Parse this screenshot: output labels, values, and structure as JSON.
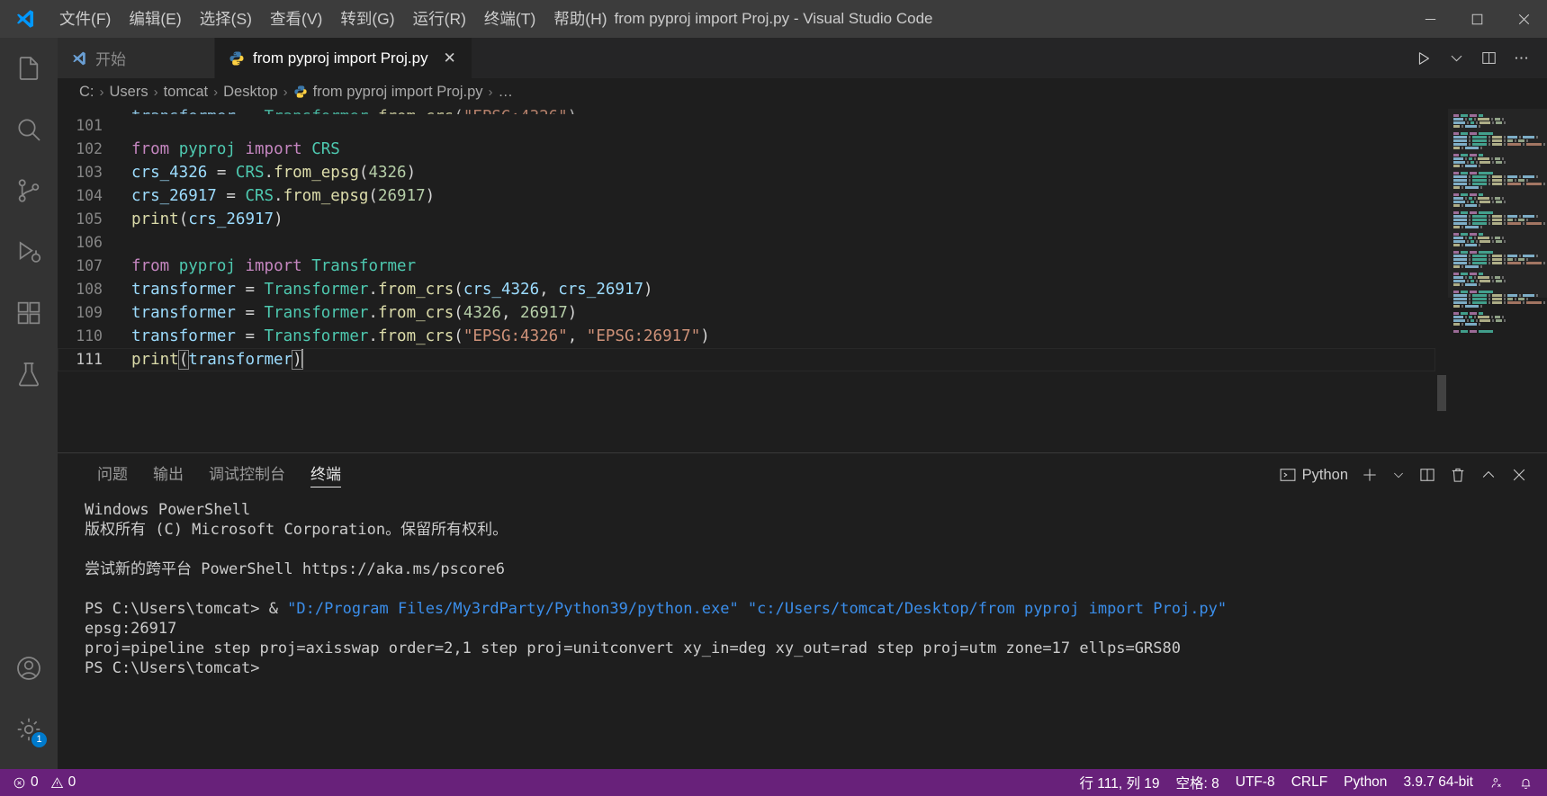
{
  "window": {
    "title": "from pyproj import Proj.py - Visual Studio Code",
    "minimize_label": "─",
    "maximize_label": "□",
    "close_label": "✕"
  },
  "menubar": {
    "items": [
      {
        "label": "文件(F)",
        "name": "menu-file"
      },
      {
        "label": "编辑(E)",
        "name": "menu-edit"
      },
      {
        "label": "选择(S)",
        "name": "menu-selection"
      },
      {
        "label": "查看(V)",
        "name": "menu-view"
      },
      {
        "label": "转到(G)",
        "name": "menu-go"
      },
      {
        "label": "运行(R)",
        "name": "menu-run"
      },
      {
        "label": "终端(T)",
        "name": "menu-terminal"
      },
      {
        "label": "帮助(H)",
        "name": "menu-help"
      }
    ]
  },
  "activitybar": {
    "items": [
      {
        "name": "explorer-icon",
        "title": "资源管理器"
      },
      {
        "name": "search-icon",
        "title": "搜索"
      },
      {
        "name": "source-control-icon",
        "title": "源代码管理"
      },
      {
        "name": "run-debug-icon",
        "title": "运行和调试"
      },
      {
        "name": "extensions-icon",
        "title": "扩展"
      },
      {
        "name": "testing-icon",
        "title": "测试"
      }
    ],
    "bottom": [
      {
        "name": "accounts-icon",
        "title": "帐户"
      },
      {
        "name": "settings-gear-icon",
        "title": "管理",
        "badge": "1"
      }
    ]
  },
  "tabs": [
    {
      "label": "开始",
      "icon": "vscode-icon",
      "active": false,
      "closable": false
    },
    {
      "label": "from pyproj import Proj.py",
      "icon": "python-icon",
      "active": true,
      "closable": true,
      "close_label": "✕"
    }
  ],
  "editor_actions": [
    {
      "name": "run-python-file-button",
      "icon": "play-icon"
    },
    {
      "name": "run-options-chevron-icon",
      "icon": "chevron-down-icon"
    },
    {
      "name": "split-editor-right-button",
      "icon": "split-icon"
    },
    {
      "name": "more-actions-button",
      "icon": "ellipsis-icon",
      "label": "⋯"
    }
  ],
  "breadcrumb": {
    "items": [
      "C:",
      "Users",
      "tomcat",
      "Desktop",
      "from pyproj import Proj.py",
      "…"
    ],
    "separator": "›",
    "file_icon": "python-icon"
  },
  "editor": {
    "first_visible_line": 101,
    "cursor_line": 111,
    "lines": [
      {
        "no": 101,
        "tokens": []
      },
      {
        "no": 102,
        "tokens": [
          {
            "t": "from",
            "c": "kw"
          },
          {
            "t": " ",
            "c": "pn"
          },
          {
            "t": "pyproj",
            "c": "typ"
          },
          {
            "t": " ",
            "c": "pn"
          },
          {
            "t": "import",
            "c": "kw"
          },
          {
            "t": " ",
            "c": "pn"
          },
          {
            "t": "CRS",
            "c": "typ"
          }
        ]
      },
      {
        "no": 103,
        "tokens": [
          {
            "t": "crs_4326",
            "c": "var"
          },
          {
            "t": " = ",
            "c": "pn"
          },
          {
            "t": "CRS",
            "c": "typ"
          },
          {
            "t": ".",
            "c": "pn"
          },
          {
            "t": "from_epsg",
            "c": "fn"
          },
          {
            "t": "(",
            "c": "pn"
          },
          {
            "t": "4326",
            "c": "num"
          },
          {
            "t": ")",
            "c": "pn"
          }
        ]
      },
      {
        "no": 104,
        "tokens": [
          {
            "t": "crs_26917",
            "c": "var"
          },
          {
            "t": " = ",
            "c": "pn"
          },
          {
            "t": "CRS",
            "c": "typ"
          },
          {
            "t": ".",
            "c": "pn"
          },
          {
            "t": "from_epsg",
            "c": "fn"
          },
          {
            "t": "(",
            "c": "pn"
          },
          {
            "t": "26917",
            "c": "num"
          },
          {
            "t": ")",
            "c": "pn"
          }
        ]
      },
      {
        "no": 105,
        "tokens": [
          {
            "t": "print",
            "c": "fn"
          },
          {
            "t": "(",
            "c": "pn"
          },
          {
            "t": "crs_26917",
            "c": "var"
          },
          {
            "t": ")",
            "c": "pn"
          }
        ]
      },
      {
        "no": 106,
        "tokens": []
      },
      {
        "no": 107,
        "tokens": [
          {
            "t": "from",
            "c": "kw"
          },
          {
            "t": " ",
            "c": "pn"
          },
          {
            "t": "pyproj",
            "c": "typ"
          },
          {
            "t": " ",
            "c": "pn"
          },
          {
            "t": "import",
            "c": "kw"
          },
          {
            "t": " ",
            "c": "pn"
          },
          {
            "t": "Transformer",
            "c": "typ"
          }
        ]
      },
      {
        "no": 108,
        "tokens": [
          {
            "t": "transformer",
            "c": "var"
          },
          {
            "t": " = ",
            "c": "pn"
          },
          {
            "t": "Transformer",
            "c": "typ"
          },
          {
            "t": ".",
            "c": "pn"
          },
          {
            "t": "from_crs",
            "c": "fn"
          },
          {
            "t": "(",
            "c": "pn"
          },
          {
            "t": "crs_4326",
            "c": "var"
          },
          {
            "t": ", ",
            "c": "pn"
          },
          {
            "t": "crs_26917",
            "c": "var"
          },
          {
            "t": ")",
            "c": "pn"
          }
        ]
      },
      {
        "no": 109,
        "tokens": [
          {
            "t": "transformer",
            "c": "var"
          },
          {
            "t": " = ",
            "c": "pn"
          },
          {
            "t": "Transformer",
            "c": "typ"
          },
          {
            "t": ".",
            "c": "pn"
          },
          {
            "t": "from_crs",
            "c": "fn"
          },
          {
            "t": "(",
            "c": "pn"
          },
          {
            "t": "4326",
            "c": "num"
          },
          {
            "t": ", ",
            "c": "pn"
          },
          {
            "t": "26917",
            "c": "num"
          },
          {
            "t": ")",
            "c": "pn"
          }
        ]
      },
      {
        "no": 110,
        "tokens": [
          {
            "t": "transformer",
            "c": "var"
          },
          {
            "t": " = ",
            "c": "pn"
          },
          {
            "t": "Transformer",
            "c": "typ"
          },
          {
            "t": ".",
            "c": "pn"
          },
          {
            "t": "from_crs",
            "c": "fn"
          },
          {
            "t": "(",
            "c": "pn"
          },
          {
            "t": "\"EPSG:4326\"",
            "c": "str"
          },
          {
            "t": ", ",
            "c": "pn"
          },
          {
            "t": "\"EPSG:26917\"",
            "c": "str"
          },
          {
            "t": ")",
            "c": "pn"
          }
        ]
      },
      {
        "no": 111,
        "tokens": [
          {
            "t": "print",
            "c": "fn"
          },
          {
            "t": "(",
            "c": "pn br-match"
          },
          {
            "t": "transformer",
            "c": "var"
          },
          {
            "t": ")",
            "c": "pn br-match"
          }
        ]
      }
    ]
  },
  "panel": {
    "tabs": [
      {
        "label": "问题",
        "name": "tab-problems",
        "active": false
      },
      {
        "label": "输出",
        "name": "tab-output",
        "active": false
      },
      {
        "label": "调试控制台",
        "name": "tab-debug-console",
        "active": false
      },
      {
        "label": "终端",
        "name": "tab-terminal",
        "active": true
      }
    ],
    "actions": {
      "shell_label": "Python",
      "new_terminal_icon": "plus-icon",
      "new_terminal_dropdown_icon": "chevron-down-icon",
      "split_icon": "split-icon",
      "kill_icon": "trash-icon",
      "maximize_icon": "chevron-up-icon",
      "close_icon": "close-icon"
    },
    "terminal_lines": [
      {
        "segs": [
          {
            "t": "Windows PowerShell"
          }
        ]
      },
      {
        "segs": [
          {
            "t": "版权所有 (C) Microsoft Corporation。保留所有权利。"
          }
        ]
      },
      {
        "segs": [
          {
            "t": ""
          }
        ]
      },
      {
        "segs": [
          {
            "t": "尝试新的跨平台 PowerShell https://aka.ms/pscore6"
          }
        ]
      },
      {
        "segs": [
          {
            "t": ""
          }
        ]
      },
      {
        "segs": [
          {
            "t": "PS C:\\Users\\tomcat> & "
          },
          {
            "t": "\"D:/Program Files/My3rdParty/Python39/python.exe\" \"c:/Users/tomcat/Desktop/from pyproj import Proj.py\"",
            "c": "t-cyan"
          }
        ]
      },
      {
        "segs": [
          {
            "t": "epsg:26917"
          }
        ]
      },
      {
        "segs": [
          {
            "t": "proj=pipeline step proj=axisswap order=2,1 step proj=unitconvert xy_in=deg xy_out=rad step proj=utm zone=17 ellps=GRS80"
          }
        ]
      },
      {
        "segs": [
          {
            "t": "PS C:\\Users\\tomcat>"
          }
        ]
      }
    ]
  },
  "statusbar": {
    "left": [
      {
        "name": "problems-status",
        "icon": "error-icon",
        "text": "0",
        "icon2": "warning-icon",
        "text2": "0"
      }
    ],
    "error_count": "0",
    "warning_count": "0",
    "right": [
      {
        "name": "editor-position",
        "label": "行 111, 列 19"
      },
      {
        "name": "editor-indentation",
        "label": "空格: 8"
      },
      {
        "name": "editor-encoding",
        "label": "UTF-8"
      },
      {
        "name": "editor-eol",
        "label": "CRLF"
      },
      {
        "name": "editor-language",
        "label": "Python"
      },
      {
        "name": "python-interpreter",
        "label": "3.9.7 64-bit"
      }
    ],
    "feedback_icon": "feedback-icon",
    "bell_icon": "bell-icon"
  },
  "colors": {
    "titlebar_bg": "#3c3c3c",
    "activitybar_bg": "#333333",
    "editor_bg": "#1e1e1e",
    "tab_inactive_bg": "#2d2d2d",
    "statusbar_bg": "#68217a",
    "accent": "#007acc",
    "terminal_cyan": "#3b8eea"
  }
}
